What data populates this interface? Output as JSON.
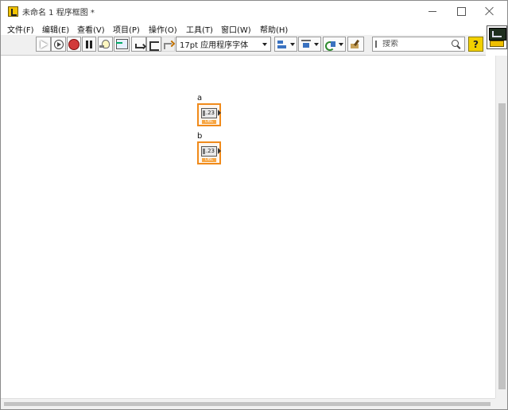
{
  "window": {
    "title": "未命名 1 程序框图 *"
  },
  "menu": {
    "items": [
      {
        "label": "文件(F)"
      },
      {
        "label": "编辑(E)"
      },
      {
        "label": "查看(V)"
      },
      {
        "label": "项目(P)"
      },
      {
        "label": "操作(O)"
      },
      {
        "label": "工具(T)"
      },
      {
        "label": "窗口(W)"
      },
      {
        "label": "帮助(H)"
      }
    ]
  },
  "toolbar": {
    "font_label": "17pt 应用程序字体",
    "search_placeholder": "搜索",
    "help_label": "?"
  },
  "icons": {
    "run": "run-arrow-icon",
    "run_continuously": "run-continuously-icon",
    "abort": "abort-stop-icon",
    "pause": "pause-icon",
    "highlight": "highlight-execution-bulb-icon",
    "retain_wire_values": "retain-wire-values-icon",
    "step_into": "step-into-icon",
    "step_over": "step-over-icon",
    "step_out": "step-out-icon",
    "align": "align-objects-icon",
    "distribute": "distribute-objects-icon",
    "reorder": "reorder-icon",
    "cleanup": "clean-up-diagram-icon",
    "search": "search-icon",
    "help": "context-help-icon",
    "vi": "vi-icon"
  },
  "diagram": {
    "terminals": [
      {
        "label": "a",
        "display": "1.23",
        "type": "DBL"
      },
      {
        "label": "b",
        "display": "1.23",
        "type": "DBL"
      }
    ]
  },
  "colors": {
    "terminal_border": "#f08a1a",
    "abort": "#d23a3a",
    "help_bg": "#f2d000"
  }
}
